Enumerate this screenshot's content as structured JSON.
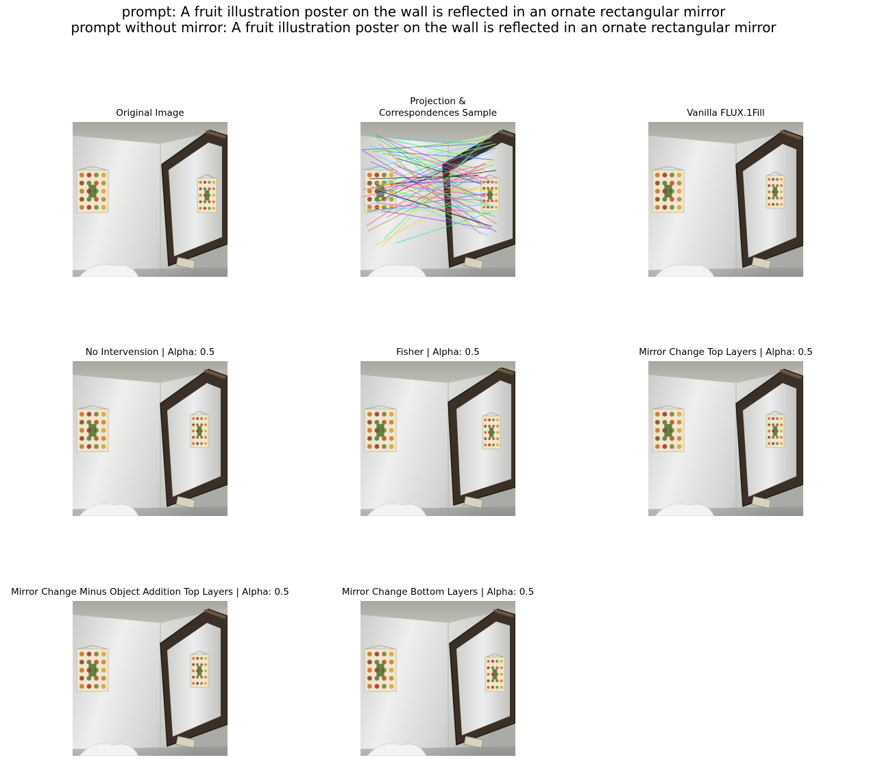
{
  "figure": {
    "prompt_line": "prompt: A fruit illustration poster on the wall is reflected in an ornate rectangular mirror",
    "prompt_without_mirror_line": "prompt without mirror: A fruit illustration poster on the wall is reflected in an ornate rectangular mirror"
  },
  "panels": [
    {
      "title_line1": "Original Image",
      "title_line2": ""
    },
    {
      "title_line1": "Projection &",
      "title_line2": "Correspondences Sample"
    },
    {
      "title_line1": "Vanilla FLUX.1Fill",
      "title_line2": ""
    },
    {
      "title_line1": "No Intervension | Alpha: 0.5",
      "title_line2": ""
    },
    {
      "title_line1": "Fisher | Alpha: 0.5",
      "title_line2": ""
    },
    {
      "title_line1": "Mirror Change Top Layers | Alpha: 0.5",
      "title_line2": ""
    },
    {
      "title_line1": "Mirror Change Minus Object Addition Top Layers | Alpha: 0.5",
      "title_line2": ""
    },
    {
      "title_line1": "Mirror Change Bottom Layers | Alpha: 0.5",
      "title_line2": ""
    }
  ],
  "colors": {
    "wall_light": "#e6e7e6",
    "wall_shadow": "#9c9d99",
    "frame": "#3a3026",
    "poster": "#efe6cc"
  }
}
